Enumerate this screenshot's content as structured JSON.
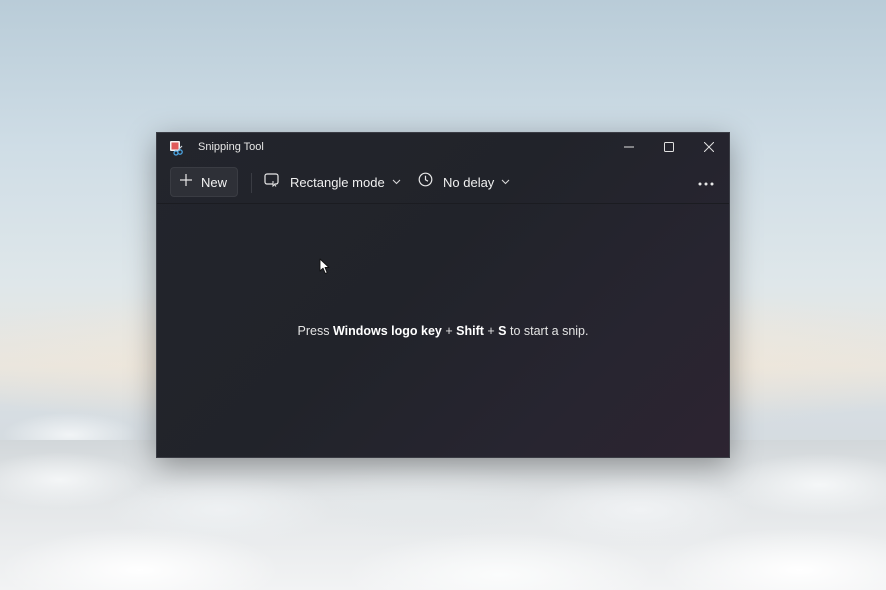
{
  "window": {
    "title": "Snipping Tool"
  },
  "toolbar": {
    "new_label": "New",
    "mode_label": "Rectangle mode",
    "delay_label": "No delay"
  },
  "content": {
    "hint_prefix": "Press ",
    "hint_key1": "Windows logo key",
    "hint_plus1": " + ",
    "hint_key2": "Shift",
    "hint_plus2": " + ",
    "hint_key3": "S",
    "hint_suffix": " to start a snip."
  },
  "icons": {
    "app": "snipping-tool-icon",
    "minimize": "minimize-icon",
    "maximize": "maximize-icon",
    "close": "close-icon",
    "new": "plus-icon",
    "mode": "rectangle-mode-icon",
    "delay": "clock-icon",
    "more": "more-icon"
  },
  "colors": {
    "window_bg": "#23252c",
    "accent_icon": "#e05a5a"
  }
}
